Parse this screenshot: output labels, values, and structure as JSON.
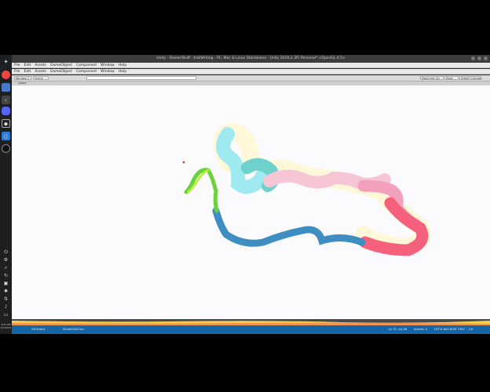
{
  "window": {
    "title": "Unity - ShaderStuff - trailWriting - PC, Mac & Linux Standalone - Unity 2019.2.3f1 Personal* <OpenGL 4.5>"
  },
  "menu": [
    "File",
    "Edit",
    "Assets",
    "GameObject",
    "Component",
    "Window",
    "Help"
  ],
  "toolbar": {
    "layout_label": "Window 1",
    "view_label": "Scene",
    "play_button": "Maximize On Play",
    "mute_button": "Mute Audio",
    "stats_button": "Stats",
    "gizmos_button": "Gizmos"
  },
  "scene_tab": "Game",
  "status": {
    "git_label": "Git Status",
    "project_label": "ShaderStuff.sln",
    "cursor_pos": "Ln 70, Col 46",
    "spaces": "Spaces: 4",
    "encoding": "UTF-8 with BOM",
    "eol": "CRLF",
    "lang": "C#"
  },
  "dock": {
    "clock": "4:51 PM",
    "date": "9/7/2019"
  },
  "trail": {
    "colors": [
      "#8ee6ea",
      "#6fd6d0",
      "#f7c7d6",
      "#f2a3bd",
      "#f6647e",
      "#3a8dbf",
      "#79d64a",
      "#b6f23c"
    ]
  }
}
